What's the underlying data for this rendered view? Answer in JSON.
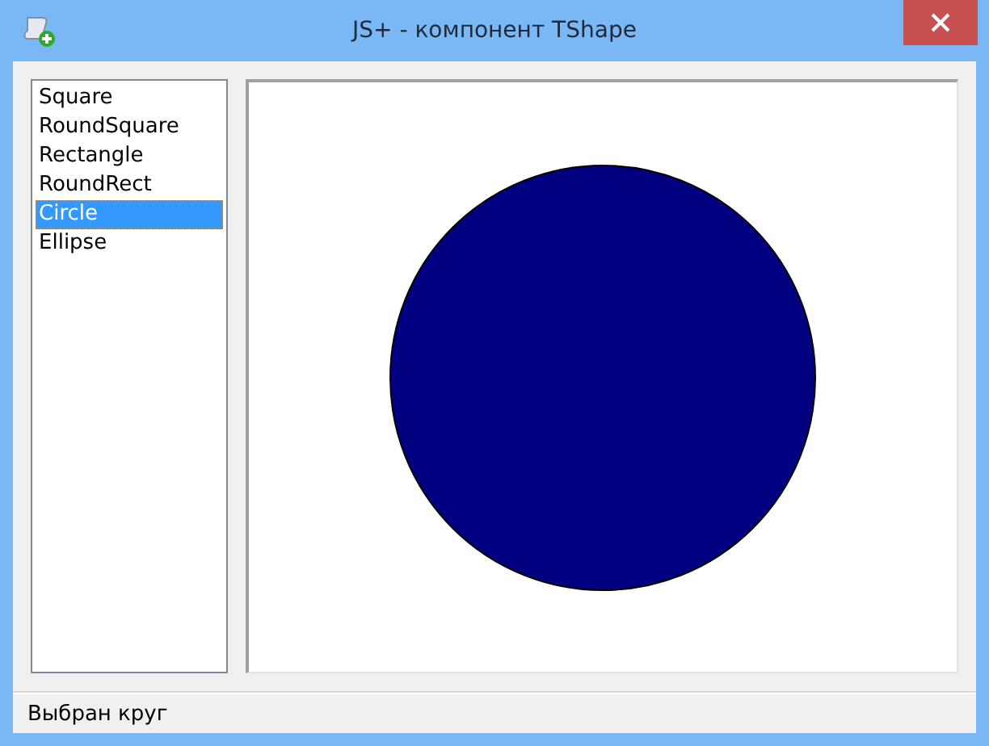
{
  "window": {
    "title": "JS+ - компонент TShape"
  },
  "shape_list": {
    "items": [
      {
        "label": "Square",
        "selected": false
      },
      {
        "label": "RoundSquare",
        "selected": false
      },
      {
        "label": "Rectangle",
        "selected": false
      },
      {
        "label": "RoundRect",
        "selected": false
      },
      {
        "label": "Circle",
        "selected": true
      },
      {
        "label": "Ellipse",
        "selected": false
      }
    ]
  },
  "canvas": {
    "shape": {
      "kind": "circle"
    }
  },
  "status_bar": {
    "text": "Выбран круг"
  }
}
